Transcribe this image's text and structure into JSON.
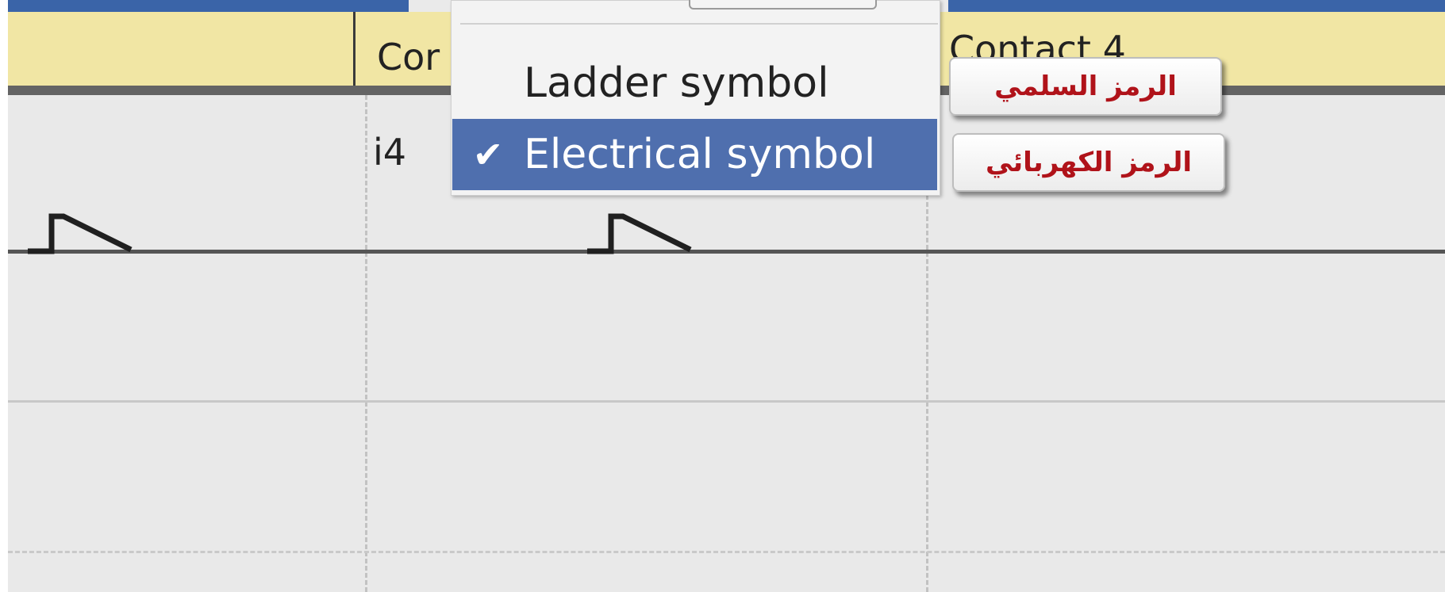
{
  "header": {
    "col1_text": "Cor",
    "col3_text": "Contact 4"
  },
  "grid": {
    "cell_text": "i4"
  },
  "context_menu": {
    "items": [
      {
        "label": "Ladder symbol",
        "checked": false,
        "check_glyph": ""
      },
      {
        "label": "Electrical symbol",
        "checked": true,
        "check_glyph": "✔"
      }
    ]
  },
  "tooltips": {
    "ladder": "الرمز السلمي",
    "electrical": "الرمز الكهربائي"
  },
  "colors": {
    "header_bg": "#f1e6a4",
    "selection": "#4f6fae",
    "titlebar": "#3a64a8",
    "tooltip_text": "#b0131a"
  },
  "icons": {
    "contact_symbol": "normally-open-contact-icon",
    "checkmark": "check-icon"
  }
}
